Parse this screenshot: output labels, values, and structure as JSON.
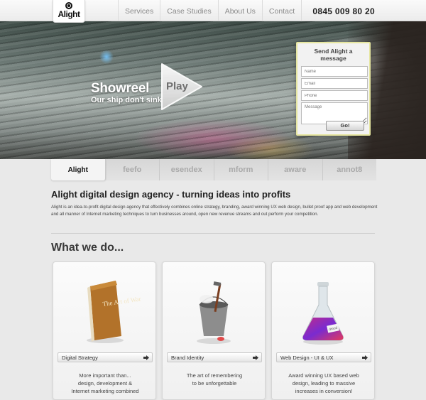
{
  "header": {
    "logo_text": "Alight",
    "nav": [
      "Services",
      "Case Studies",
      "About Us",
      "Contact"
    ],
    "phone": "0845 009 80 20"
  },
  "hero": {
    "showreel_title": "Showreel",
    "showreel_sub": "Our ship don't sink",
    "play_label": "Play",
    "form": {
      "title": "Send Alight a message",
      "name_placeholder": "Name",
      "email_placeholder": "Email",
      "phone_placeholder": "Phone",
      "message_placeholder": "Message",
      "submit_label": "Go!"
    }
  },
  "clients": [
    "Alight",
    "feefo",
    "esendex",
    "mform",
    "aware",
    "annot8"
  ],
  "intro": {
    "heading": "Alight digital design agency - turning ideas into profits",
    "body": "Alight is an idea-to-profit digital design agency that effectively combines online strategy, branding, award winning UX web design, bullet proof app and web development and all manner of Internet marketing techniques to turn businesses around, open new revenue streams and out perform your competition."
  },
  "what_we_do": {
    "heading": "What we do...",
    "cards": [
      {
        "label": "Digital Strategy",
        "desc": "More important than...\ndesign, development &\nInternet marketing combined",
        "book_text": "The Art of War"
      },
      {
        "label": "Brand Identity",
        "desc": "The art of remembering\nto be unforgettable"
      },
      {
        "label": "Web Design - UI & UX",
        "desc": "Award winning UX based web\ndesign, leading to massive\nincreases in conversion!",
        "flask_text": "dmcd"
      }
    ]
  }
}
